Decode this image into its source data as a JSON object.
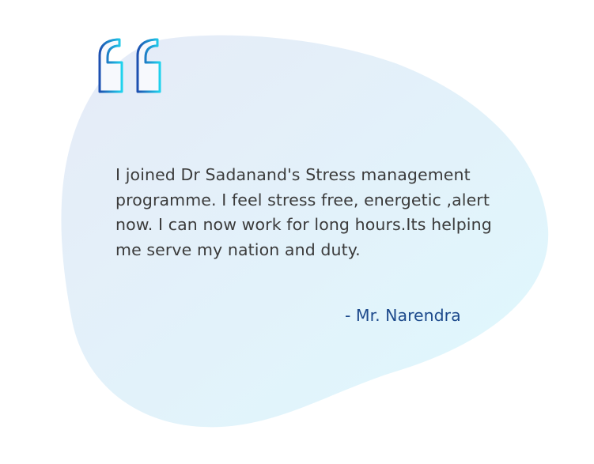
{
  "testimonial": {
    "quote_icon": "quote-open-icon",
    "text": "I joined Dr Sadanand's Stress management\nprogramme. I feel stress free, energetic ,alert\nnow. I can now work for long hours.Its helping\nme serve my nation  and duty.",
    "author": "- Mr. Narendra"
  },
  "colors": {
    "blob_start": "#e6edf7",
    "blob_end": "#e0f8fd",
    "quote_gradient_start": "#1d4fb0",
    "quote_gradient_end": "#1fd3ee",
    "text": "#3b3b3b",
    "author": "#1d4a8c"
  }
}
